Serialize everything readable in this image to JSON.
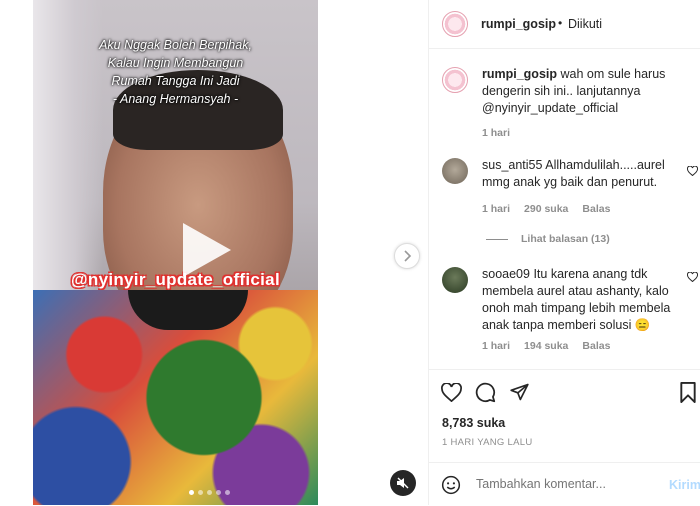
{
  "media": {
    "caption_lines": [
      "Aku Nggak Boleh Berpihak,",
      "Kalau Ingin Membangun",
      "Rumah Tangga Ini Jadi",
      "- Anang Hermansyah -"
    ],
    "watermark": "@nyinyir_update_official"
  },
  "header": {
    "username": "rumpi_gosip",
    "separator": "•",
    "follow_status": "Diikuti"
  },
  "caption": {
    "username": "rumpi_gosip",
    "text": "wah om sule harus dengerin sih ini.. lanjutannya @nyinyir_update_official",
    "time": "1 hari"
  },
  "comments": [
    {
      "username": "sus_anti55",
      "text": "Allhamdulilah.....aurel mmg anak yg baik dan penurut.",
      "time": "1 hari",
      "likes": "290 suka",
      "reply": "Balas",
      "view_replies": "Lihat balasan (13)"
    },
    {
      "username": "sooae09",
      "text": "Itu karena anang tdk membela aurel atau ashanty, kalo onoh mah timpang lebih membela anak tanpa memberi solusi 😑",
      "time": "1 hari",
      "likes": "194 suka",
      "reply": "Balas"
    }
  ],
  "actions": {
    "likes": "8,783 suka",
    "date": "1 HARI YANG LALU"
  },
  "add_comment": {
    "placeholder": "Tambahkan komentar...",
    "post_label": "Kirim"
  },
  "colors": {
    "text": "#262626",
    "muted": "#8e8e8e",
    "link": "#0095f6",
    "watermark_outline": "#e0312f"
  }
}
